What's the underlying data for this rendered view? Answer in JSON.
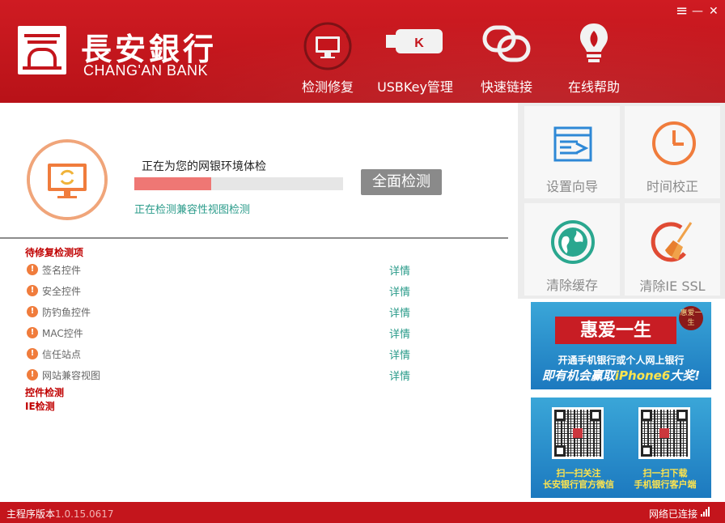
{
  "header": {
    "logo_cn": "長安銀行",
    "logo_en": "CHANG'AN BANK",
    "window_menu": "≡",
    "window_minimize": "—",
    "window_close": "✕",
    "nav": [
      {
        "label": "检测修复",
        "icon": "monitor-refresh-icon"
      },
      {
        "label": "USBKey管理",
        "icon": "usbkey-icon"
      },
      {
        "label": "快速链接",
        "icon": "link-icon"
      },
      {
        "label": "在线帮助",
        "icon": "lightbulb-icon"
      }
    ]
  },
  "check": {
    "title": "正在为您的网银环境体检",
    "progress": 0.37,
    "status": "正在检测兼容性视图检测",
    "button": "全面检测"
  },
  "pending": {
    "heading": "待修复检测项",
    "items": [
      {
        "name": "签名控件",
        "detail": "详情"
      },
      {
        "name": "安全控件",
        "detail": "详情"
      },
      {
        "name": "防钓鱼控件",
        "detail": "详情"
      },
      {
        "name": "MAC控件",
        "detail": "详情"
      },
      {
        "name": "信任站点",
        "detail": "详情"
      },
      {
        "name": "网站兼容视图",
        "detail": "详情"
      }
    ],
    "section2": "控件检测",
    "section3": "IE检测"
  },
  "tiles": [
    {
      "label": "设置向导",
      "icon": "setup-wizard-icon"
    },
    {
      "label": "时间校正",
      "icon": "clock-icon"
    },
    {
      "label": "清除缓存",
      "icon": "globe-icon"
    },
    {
      "label": "清除IE SSL",
      "icon": "broom-icon"
    }
  ],
  "banner1": {
    "title": "惠爱一生",
    "badge": "惠爱一生",
    "line1": "开通手机银行或个人网上银行",
    "line2_a": "即有机会赢取",
    "line2_b": "iPhone6",
    "line2_c": "大奖!"
  },
  "banner2": {
    "qr1_text_1": "扫一扫关注",
    "qr1_text_2": "长安银行官方微信",
    "qr2_text_1": "扫一扫下载",
    "qr2_text_2": "手机银行客户端"
  },
  "footer": {
    "version_label": "主程序版本",
    "version": "1.0.15.0617",
    "network": "网络已连接"
  },
  "colors": {
    "brand_red": "#c4151c",
    "teal": "#2a9b8a",
    "orange": "#f07c3c"
  }
}
